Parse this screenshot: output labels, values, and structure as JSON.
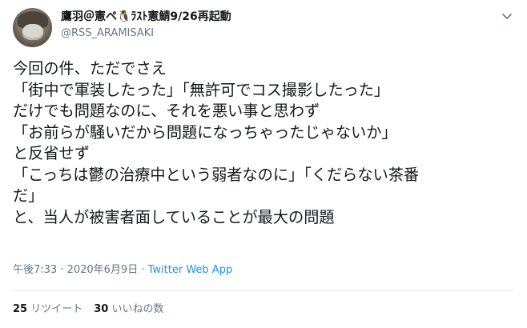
{
  "tweet": {
    "display_name": "鷹羽＠憲ペ🐧ﾗｽﾄ憲鯖9/26再起動",
    "handle": "@RSS_ARAMISAKI",
    "caret_icon": "chevron-down-icon",
    "lines": [
      "今回の件、ただでさえ",
      "「街中で軍装したった」「無許可でコス撮影したった」",
      "だけでも問題なのに、それを悪い事と思わず",
      "「お前らが騒いだから問題になっちゃったじゃないか」",
      "と反省せず",
      "「こっちは鬱の治療中という弱者なのに」「くだらない茶番",
      "だ」",
      "と、当人が被害者面していることが最大の問題"
    ],
    "timestamp": "午後7:33 · 2020年6月9日",
    "separator": " · ",
    "source": "Twitter Web App",
    "retweet_count": "25",
    "retweet_label": "リツイート",
    "like_count": "30",
    "like_label": "いいねの数"
  },
  "colors": {
    "text": "#14171a",
    "secondary": "#657786",
    "link": "#1b95e0",
    "divider": "#e6ecf0"
  }
}
